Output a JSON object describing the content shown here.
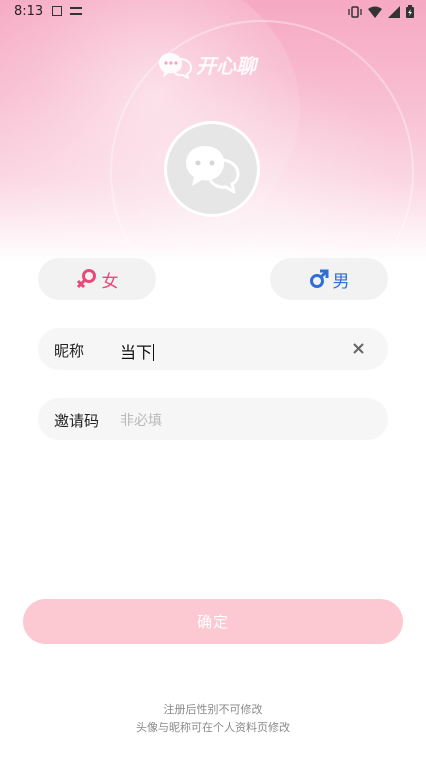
{
  "status_bar": {
    "time": "8:13"
  },
  "app": {
    "logo_text": "开心聊"
  },
  "gender": {
    "female_label": "女",
    "male_label": "男"
  },
  "nickname": {
    "label": "昵称",
    "value": "当下"
  },
  "invite_code": {
    "label": "邀请码",
    "placeholder": "非必填"
  },
  "confirm_button": {
    "label": "确定"
  },
  "notes": {
    "line1": "注册后性别不可修改",
    "line2": "头像与昵称可在个人资料页修改"
  },
  "colors": {
    "hero_pink": "#f6a9c3",
    "female": "#e8497a",
    "male": "#2f6fd6",
    "confirm_bg": "#fcc8d2"
  }
}
